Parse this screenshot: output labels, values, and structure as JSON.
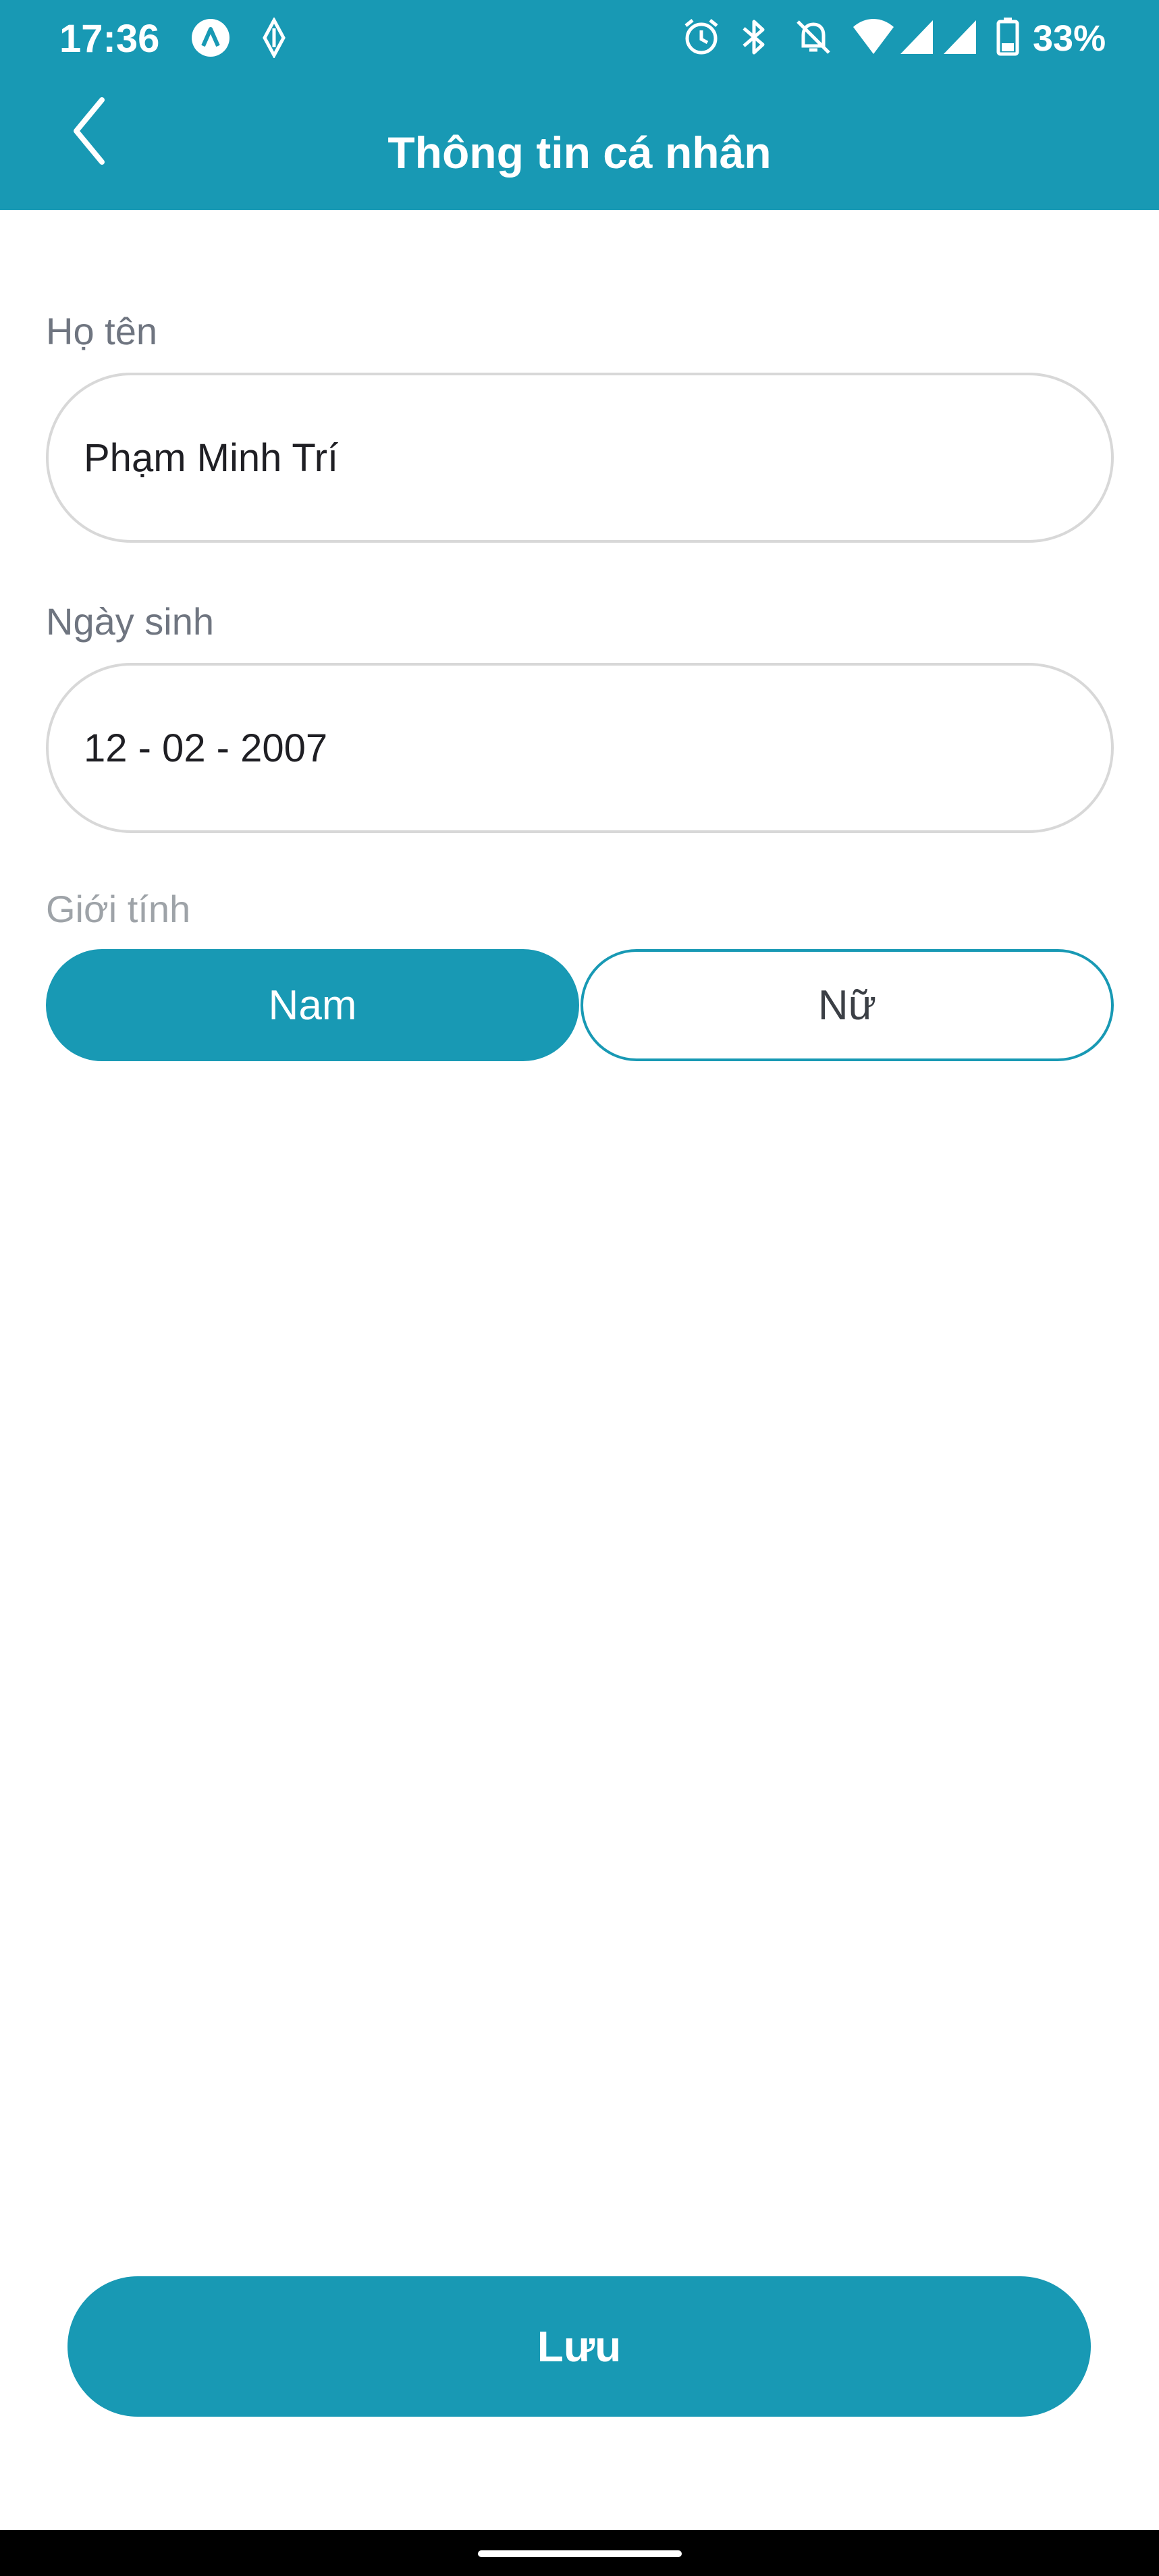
{
  "status_bar": {
    "time": "17:36",
    "battery": "33%",
    "icons": [
      "app-a-notification-icon",
      "app-diamond-notification-icon",
      "alarm-icon",
      "bluetooth-icon",
      "bell-muted-icon",
      "wifi-icon",
      "signal-icon",
      "signal-icon",
      "battery-icon"
    ]
  },
  "header": {
    "title": "Thông tin cá nhân",
    "back_icon": "chevron-left-icon"
  },
  "form": {
    "name": {
      "label": "Họ tên",
      "value": "Phạm Minh Trí"
    },
    "birthdate": {
      "label": "Ngày sinh",
      "value": "12 - 02 - 2007"
    },
    "gender": {
      "label": "Giới tính",
      "options": [
        "Nam",
        "Nữ"
      ],
      "selected": "Nam"
    }
  },
  "save_button": {
    "label": "Lưu"
  },
  "colors": {
    "primary": "#1899b4",
    "label": "#6f7580",
    "border": "#d8d8d8"
  }
}
